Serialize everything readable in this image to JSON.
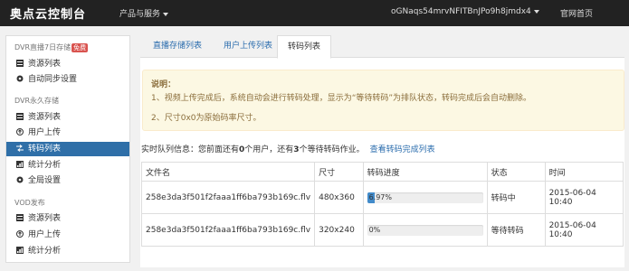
{
  "header": {
    "brand": "奥点云控制台",
    "products_menu": "产品与服务",
    "user": "oGNaqs54mrvNFITBnJPo9h8jmdx4",
    "home_link": "官网首页"
  },
  "sidebar": {
    "sections": [
      {
        "title": "DVR直播7日存储",
        "badge": "免费",
        "items": [
          {
            "label": "资源列表",
            "icon": "list-icon"
          },
          {
            "label": "自动同步设置",
            "icon": "gear-icon"
          }
        ]
      },
      {
        "title": "DVR永久存储",
        "items": [
          {
            "label": "资源列表",
            "icon": "list-icon"
          },
          {
            "label": "用户上传",
            "icon": "upload-icon"
          },
          {
            "label": "转码列表",
            "icon": "transcode-icon",
            "active": true
          },
          {
            "label": "统计分析",
            "icon": "stats-icon"
          },
          {
            "label": "全局设置",
            "icon": "gear-icon"
          }
        ]
      },
      {
        "title": "VOD发布",
        "items": [
          {
            "label": "资源列表",
            "icon": "list-icon"
          },
          {
            "label": "用户上传",
            "icon": "upload-icon"
          },
          {
            "label": "统计分析",
            "icon": "stats-icon"
          }
        ]
      }
    ]
  },
  "tabs": [
    {
      "label": "直播存储列表"
    },
    {
      "label": "用户上传列表"
    },
    {
      "label": "转码列表",
      "active": true
    }
  ],
  "notice": {
    "title": "说明：",
    "line1": "1、视频上传完成后，系统自动会进行转码处理，显示为“等待转码”为排队状态，转码完成后会自动删除。",
    "line2": "2、尺寸0x0为原始码率尺寸。"
  },
  "queue": {
    "prefix": "实时队列信息：您前面还有",
    "users": "0",
    "middle": "个用户，还有",
    "jobs": "3",
    "suffix": "个等待转码作业。",
    "link": "查看转码完成列表"
  },
  "table": {
    "headers": [
      "文件名",
      "尺寸",
      "转码进度",
      "状态",
      "时间"
    ],
    "rows": [
      {
        "file": "258e3da3f501f2faaa1ff6ba793b169c.flv",
        "size": "480x360",
        "progress_text": "6.97%",
        "progress": 0.0697,
        "status": "转码中",
        "time": "2015-06-04 10:40"
      },
      {
        "file": "258e3da3f501f2faaa1ff6ba793b169c.flv",
        "size": "320x240",
        "progress_text": "0%",
        "progress": 0,
        "status": "等待转码",
        "time": "2015-06-04 10:40"
      }
    ]
  },
  "colors": {
    "topbar": "#222222",
    "active_nav": "#2f6fa8",
    "link": "#2a6cad",
    "progress_bar": "#428bca",
    "notice_bg": "#fcf8e3",
    "badge": "#d9534f"
  }
}
